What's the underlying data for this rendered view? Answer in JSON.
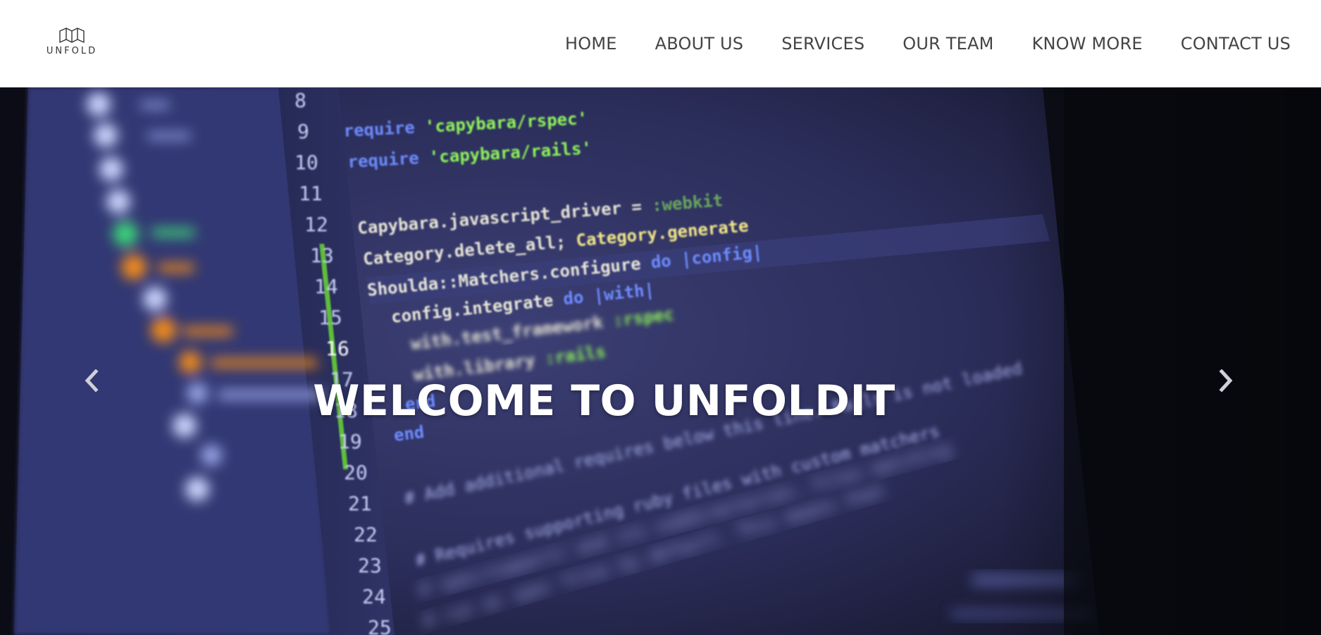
{
  "brand": {
    "name": "UNFOLD"
  },
  "nav": {
    "items": [
      {
        "label": "HOME"
      },
      {
        "label": "ABOUT US"
      },
      {
        "label": "SERVICES"
      },
      {
        "label": "OUR TEAM"
      },
      {
        "label": "KNOW MORE"
      },
      {
        "label": "CONTACT US"
      }
    ]
  },
  "hero": {
    "title": "WELCOME TO UNFOLDIT",
    "prev_icon": "chevron-left-icon",
    "next_icon": "chevron-right-icon",
    "code": {
      "line_numbers": [
        "8",
        "9",
        "10",
        "11",
        "12",
        "13",
        "14",
        "15",
        "16",
        "17",
        "18",
        "19",
        "20",
        "21",
        "22",
        "23",
        "24",
        "25"
      ],
      "lines": [
        "require 'capybara/rspec'",
        "require 'capybara/rails'",
        "Capybara.javascript_driver = :webkit",
        "Category.delete_all; Category.generate",
        "Shoulda::Matchers.configure do |config|",
        "config.integrate do |with|",
        "with.test_framework :rspec",
        "with.library :rails",
        "end",
        "end",
        "# Add additional requires below this line. Rails is not loaded until this point!",
        "# Requires supporting ruby files with custom matchers and macros, etc, in",
        "# spec/support/ and its subdirectories. Files matching `spec/**/*_spec.rb` are",
        "# run as spec files by default. This means that files in spec/support that end",
        "# in _spec.rb will both be required and run as specs, causing the specs to be"
      ]
    },
    "colors": {
      "background": "#0a0b14",
      "editor": "#2c2f5e",
      "keyword": "#6d8cff",
      "string": "#8ff55a",
      "text": "#e8e6d8",
      "comment": "#a9b2ee",
      "highlight": "#f08a1c"
    }
  }
}
